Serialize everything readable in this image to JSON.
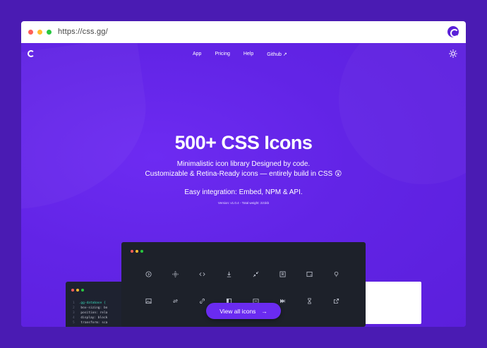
{
  "browser": {
    "url": "https://css.gg/",
    "dots": [
      "#ff5f57",
      "#ffbd2e",
      "#28c840"
    ]
  },
  "nav": {
    "items": [
      "App",
      "Pricing",
      "Help",
      "Github ↗"
    ]
  },
  "hero": {
    "title": "500+ CSS Icons",
    "line1": "Minimalistic icon library Designed by code.",
    "line2": "Customizable & Retina-Ready icons — entirely build in CSS 😲",
    "line3": "Easy integration: Embed, NPM & API.",
    "version": "Version: v1.0.4 - Total weight: 221kb"
  },
  "code": {
    "lines": [
      {
        "num": "1",
        "text": ".gg-database {"
      },
      {
        "num": "2",
        "text": "  box-sizing: bo"
      },
      {
        "num": "3",
        "text": "  position: rela"
      },
      {
        "num": "4",
        "text": "  display: block"
      },
      {
        "num": "5",
        "text": "  transform: sca"
      }
    ]
  },
  "icon_grid": {
    "row1": [
      "play-icon",
      "move-icon",
      "code-icon",
      "download-icon",
      "shrink-icon",
      "r-box-icon",
      "image-frame-icon",
      "bulb-icon"
    ],
    "row2": [
      "image-icon",
      "swap-icon",
      "link-icon",
      "window-icon",
      "eject-icon",
      "forward-icon",
      "hourglass-icon",
      "external-icon"
    ]
  },
  "cta": {
    "label": "View all icons",
    "arrow": "→"
  },
  "colors": {
    "background": "#4a1bb3",
    "hero": "#6224e6",
    "dark": "#1d212a"
  }
}
